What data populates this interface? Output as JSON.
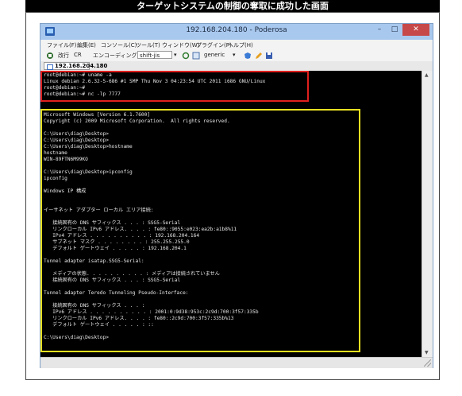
{
  "figure": {
    "title": "ターゲットシステムの制御の奪取に成功した画面"
  },
  "window": {
    "title": "192.168.204.180 - Poderosa",
    "buttons": {
      "minimize": "–",
      "maximize": "□",
      "close": "✕"
    }
  },
  "menubar": {
    "items": [
      "ファイル(F)",
      "編集(E)",
      "コンソール(C)",
      "ツール(T)",
      "ウィンドウ(W)",
      "プラグイン(P)",
      "ヘルプ(H)"
    ]
  },
  "toolbar": {
    "newline_label": "改行",
    "newline_value": "CR",
    "encoding_label": "エンコーディング",
    "encoding_value": "shift-jis",
    "terminal_value": "generic"
  },
  "tab": {
    "label": "192.168.204.180"
  },
  "terminal": {
    "lines": [
      "root@debian:~# uname -a",
      "Linux debian 2.6.32-5-686 #1 SMP Thu Nov 3 04:23:54 UTC 2011 i686 GNU/Linux",
      "root@debian:~#",
      "root@debian:~# nc -lp 7777",
      "",
      "Microsoft Windows [Version 6.1.7600]",
      "Copyright (c) 2009 Microsoft Corporation.  All rights reserved.",
      "",
      "C:\\Users\\diag\\Desktop>",
      "C:\\Users\\diag\\Desktop>",
      "C:\\Users\\diag\\Desktop>hostname",
      "hostname",
      "WIN-89FTN6M99KO",
      "",
      "C:\\Users\\diag\\Desktop>ipconfig",
      "ipconfig",
      "",
      "Windows IP 構成",
      "",
      "",
      "イーサネット アダプター ローカル エリア接続:",
      "",
      "   接続固有の DNS サフィックス . . . : SSG5-Serial",
      "   リンクローカル IPv6 アドレス. . . . : fe80::9055:e023:ea2b:a1b8%11",
      "   IPv4 アドレス . . . . . . . . . . : 192.168.204.164",
      "   サブネット マスク . . . . . . . . : 255.255.255.0",
      "   デフォルト ゲートウェイ . . . . . : 192.168.204.1",
      "",
      "Tunnel adapter isatap.SSG5-Serial:",
      "",
      "   メディアの状態. . . . . . . . . . : メディアは接続されていません",
      "   接続固有の DNS サフィックス . . . : SSG5-Serial",
      "",
      "Tunnel adapter Teredo Tunneling Pseudo-Interface:",
      "",
      "   接続固有の DNS サフィックス . . . :",
      "   IPv6 アドレス . . . . . . . . . . : 2001:0:9d38:953c:2c9d:700:3f57:335b",
      "   リンクローカル IPv6 アドレス. . . . : fe80::2c9d:700:3f57:335b%13",
      "   デフォルト ゲートウェイ . . . . . : ::",
      "",
      "C:\\Users\\diag\\Desktop>"
    ]
  },
  "colors": {
    "highlight_linux": "#e0201e",
    "highlight_windows": "#e8e020",
    "terminal_bg": "#000000",
    "terminal_fg": "#e6e6e6",
    "close_button": "#c74848"
  }
}
